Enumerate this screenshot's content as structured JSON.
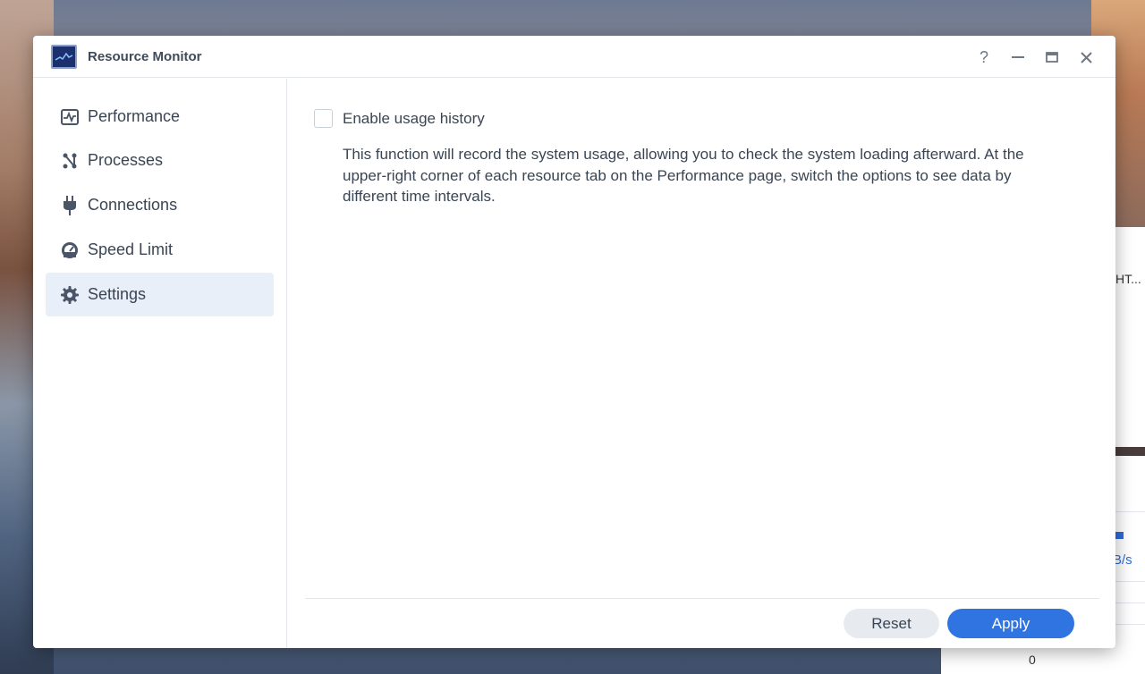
{
  "window": {
    "title": "Resource Monitor",
    "controls": {
      "help": "?",
      "minimize": "—",
      "maximize": "▭",
      "close": "✕"
    }
  },
  "sidebar": {
    "items": [
      {
        "label": "Performance",
        "icon": "performance-chart-icon"
      },
      {
        "label": "Processes",
        "icon": "processes-icon"
      },
      {
        "label": "Connections",
        "icon": "plug-icon"
      },
      {
        "label": "Speed Limit",
        "icon": "speedometer-icon"
      },
      {
        "label": "Settings",
        "icon": "gear-icon",
        "active": true
      }
    ]
  },
  "settings": {
    "checkbox_label": "Enable usage history",
    "checkbox_checked": false,
    "description": "This function will record the system usage, allowing you to check the system loading afterward. At the upper-right corner of each resource tab on the Performance page, switch the options to see data by different time intervals."
  },
  "footer": {
    "reset_label": "Reset",
    "apply_label": "Apply"
  },
  "background_window": {
    "text_1": "HT...",
    "text_2": "B/s",
    "text_3": "0"
  },
  "colors": {
    "accent": "#2f74e0",
    "active_nav_bg": "#e8eff9",
    "text": "#3a4554"
  }
}
